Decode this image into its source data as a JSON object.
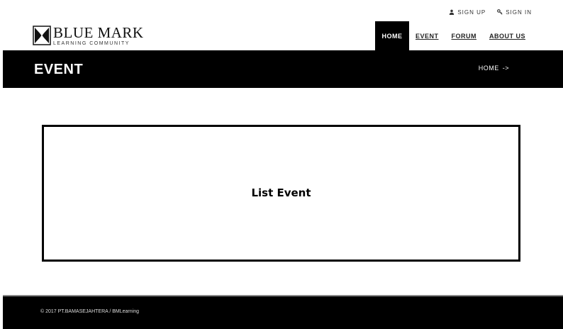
{
  "topbar": {
    "signup": {
      "label": "SIGN UP",
      "icon": "user-icon"
    },
    "signin": {
      "label": "SIGN IN",
      "icon": "key-icon"
    }
  },
  "logo": {
    "line1": "BLUE MARK",
    "line2": "LEARNING COMMUNITY",
    "icon": "bluemark-logo-icon"
  },
  "nav": {
    "items": [
      {
        "label": "HOME",
        "active": true
      },
      {
        "label": "EVENT",
        "active": false
      },
      {
        "label": "FORUM",
        "active": false
      },
      {
        "label": "ABOUT US",
        "active": false
      }
    ]
  },
  "banner": {
    "title": "EVENT",
    "breadcrumb": {
      "home": "HOME",
      "separator": "->"
    }
  },
  "main": {
    "placeholder_label": "List Event"
  },
  "footer": {
    "copyright": "© 2017 PT.BAMASEJAHTERA / BMLearning"
  },
  "colors": {
    "header_bg": "#000000",
    "page_bg": "#ffffff",
    "text_on_dark": "#ffffff"
  }
}
